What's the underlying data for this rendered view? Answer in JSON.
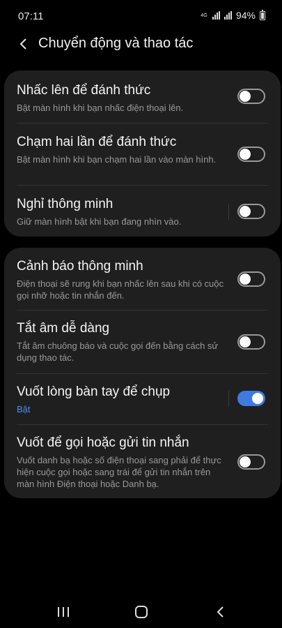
{
  "status_bar": {
    "time": "07:11",
    "network": "4G",
    "battery_percent": "94%"
  },
  "header": {
    "title": "Chuyển động và thao tác"
  },
  "groups": [
    {
      "items": [
        {
          "title": "Nhấc lên để đánh thức",
          "subtitle": "Bật màn hình khi bạn nhấc điện thoại lên.",
          "enabled": false
        },
        {
          "title": "Chạm hai lần để đánh thức",
          "subtitle": "Bật màn hình khi bạn chạm hai lần vào màn hình.",
          "enabled": false
        },
        {
          "title": "Nghỉ thông minh",
          "subtitle": "Giữ màn hình bật khi bạn đang nhìn vào.",
          "enabled": false
        }
      ]
    },
    {
      "items": [
        {
          "title": "Cảnh báo thông minh",
          "subtitle": "Điện thoại sẽ rung khi bạn nhấc lên sau khi có cuộc gọi nhỡ hoặc tin nhắn đến.",
          "enabled": false
        },
        {
          "title": "Tắt âm dễ dàng",
          "subtitle": "Tắt âm chuông báo và cuộc gọi đến bằng cách sử dụng thao tác.",
          "enabled": false
        },
        {
          "title": "Vuốt lòng bàn tay để chụp",
          "subtitle": "Bật",
          "enabled": true
        },
        {
          "title": "Vuốt để gọi hoặc gửi tin nhắn",
          "subtitle": "Vuốt danh bạ hoặc số điện thoại sang phải để thực hiện cuộc gọi hoặc sang trái để gửi tin nhắn trên màn hình Điện thoại hoặc Danh bạ.",
          "enabled": false
        }
      ]
    }
  ],
  "colors": {
    "accent": "#3e7be0",
    "card_bg": "#1f1f1f",
    "secondary_text": "#9a9a9a"
  },
  "icons": [
    "back-arrow-icon",
    "recents-icon",
    "home-icon",
    "nav-back-icon"
  ]
}
